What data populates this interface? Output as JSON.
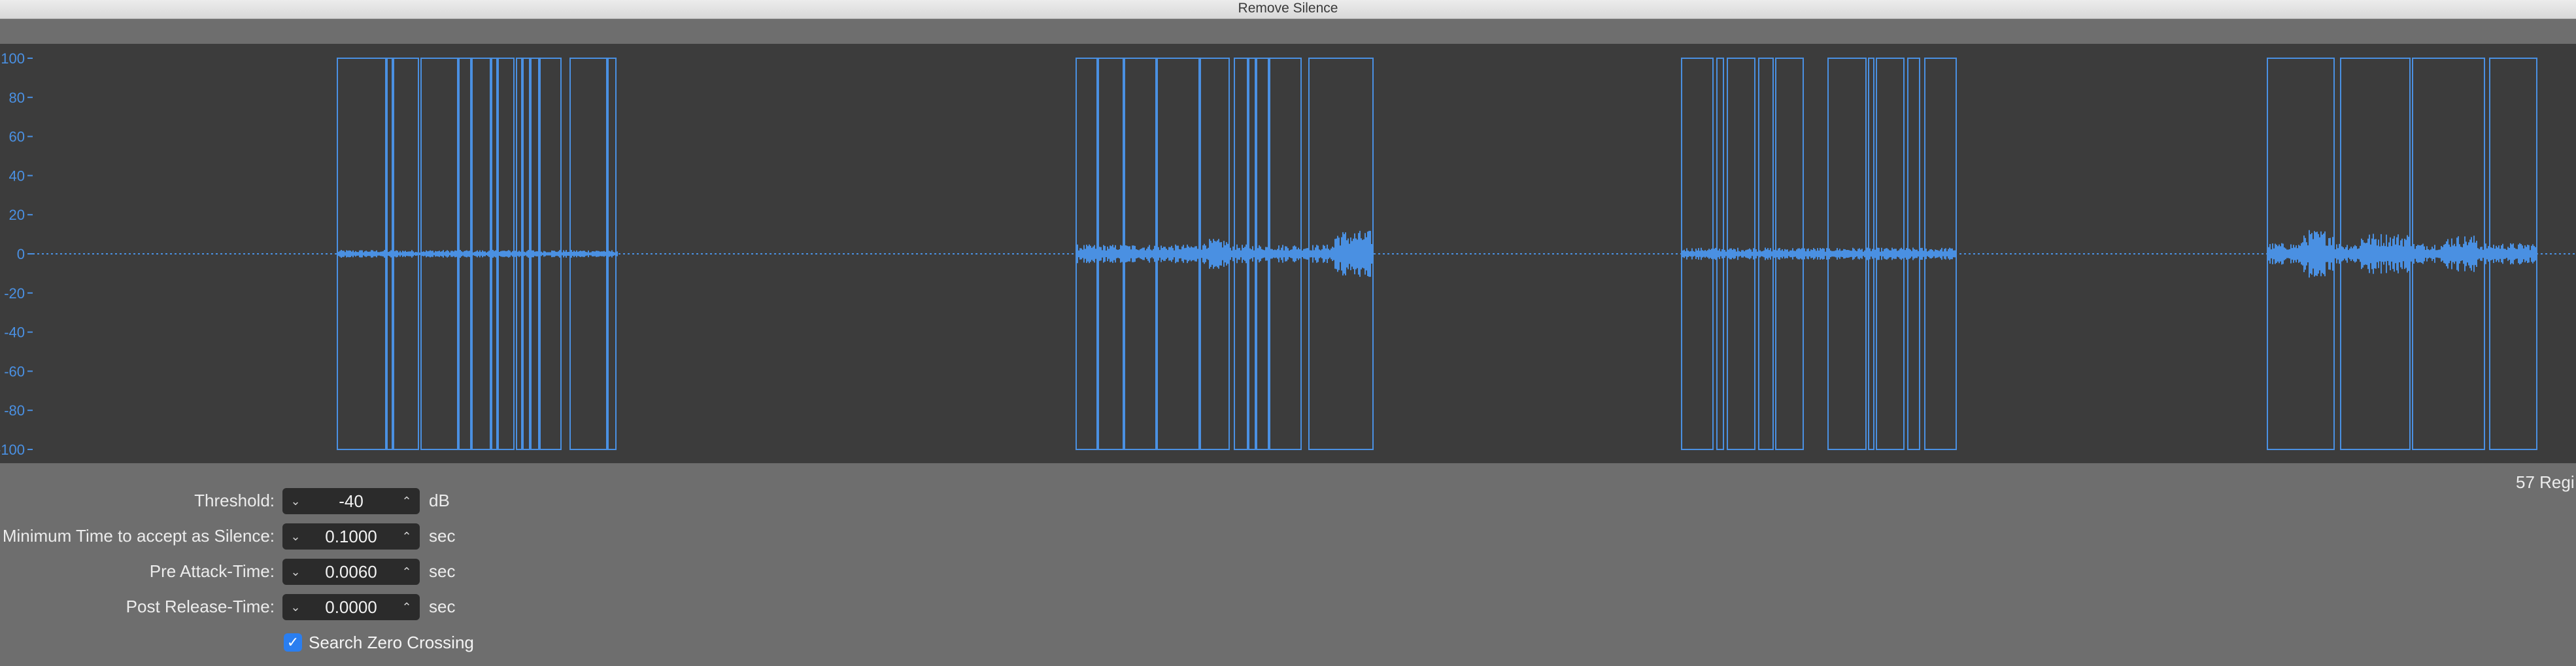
{
  "window": {
    "title": "Remove Silence"
  },
  "waveform": {
    "y_axis_ticks": [
      "100",
      "80",
      "60",
      "40",
      "20",
      "0",
      "-20",
      "-40",
      "-60",
      "-80",
      "-100"
    ],
    "accent_color": "#4a90e2",
    "background_color": "#3c3c3c"
  },
  "status": {
    "regions_label": "57 Regi"
  },
  "controls": {
    "threshold": {
      "label": "Threshold:",
      "value": "-40",
      "unit": "dB"
    },
    "min_time": {
      "label": "Minimum Time to accept as Silence:",
      "value": "0.1000",
      "unit": "sec"
    },
    "pre_attack": {
      "label": "Pre Attack-Time:",
      "value": "0.0060",
      "unit": "sec"
    },
    "post_release": {
      "label": "Post Release-Time:",
      "value": "0.0000",
      "unit": "sec"
    },
    "zero_crossing": {
      "label": "Search Zero Crossing",
      "checked": true
    }
  },
  "icons": {
    "decrement": "chevron-down-icon",
    "increment": "chevron-up-icon",
    "check": "checkmark-icon"
  }
}
